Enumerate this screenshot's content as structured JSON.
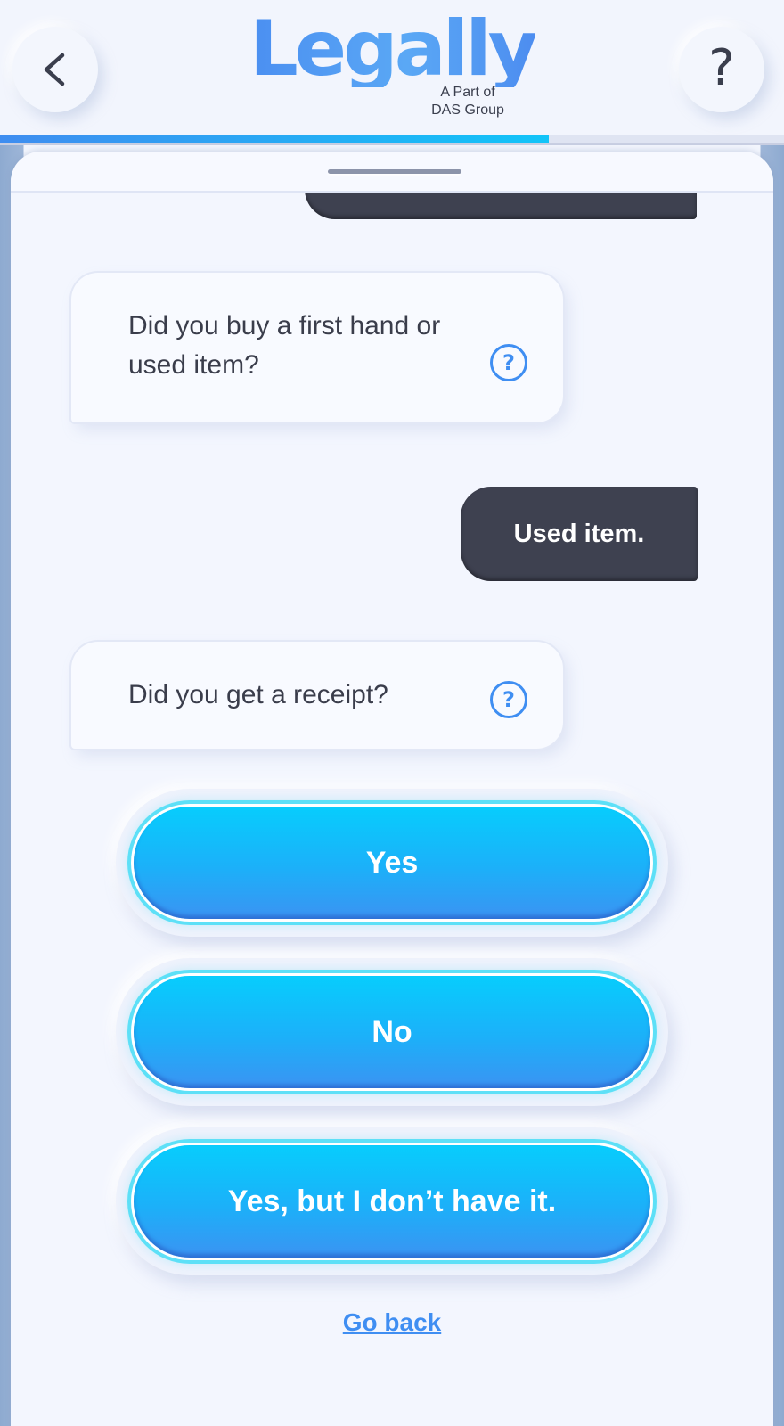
{
  "header": {
    "logo_word": "Legally",
    "logo_sub_line1": "A Part of",
    "logo_sub_line2": "DAS Group",
    "help_label": "?",
    "progress_fraction": 0.7
  },
  "chat": {
    "messages": [
      {
        "role": "user",
        "text": ""
      },
      {
        "role": "bot",
        "text": "Did you buy a first hand or used item?"
      },
      {
        "role": "user",
        "text": "Used item."
      },
      {
        "role": "bot",
        "text": "Did you get a receipt?"
      }
    ]
  },
  "answers": [
    "Yes",
    "No",
    "Yes, but I don’t have it."
  ],
  "go_back_label": "Go back",
  "colors": {
    "accent": "#3f8ef2",
    "button_top": "#07cdfd",
    "button_bottom": "#3b93f2",
    "user_bubble": "#3e4150",
    "background": "#f2f5fd"
  },
  "icons": {
    "back": "chevron-left-icon",
    "help": "question-mark-icon",
    "info": "circle-question-icon"
  }
}
